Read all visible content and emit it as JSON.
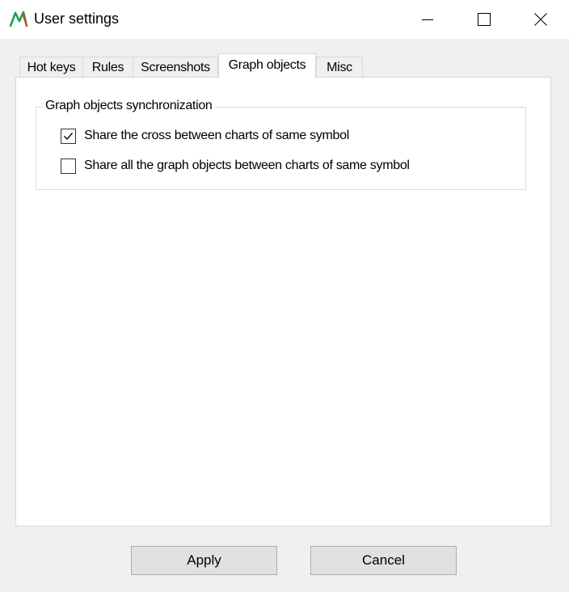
{
  "window": {
    "title": "User settings",
    "icon": "app-logo-icon",
    "controls": [
      "minimize-icon",
      "maximize-icon",
      "close-icon"
    ]
  },
  "tabs": [
    {
      "label": "Hot keys",
      "active": false
    },
    {
      "label": "Rules",
      "active": false
    },
    {
      "label": "Screenshots",
      "active": false
    },
    {
      "label": "Graph objects",
      "active": true
    },
    {
      "label": "Misc",
      "active": false
    }
  ],
  "group": {
    "legend": "Graph objects synchronization",
    "options": [
      {
        "label": "Share the cross between charts of same symbol",
        "checked": true
      },
      {
        "label": "Share all the graph objects between charts of same symbol",
        "checked": false
      }
    ]
  },
  "buttons": {
    "apply": "Apply",
    "cancel": "Cancel"
  },
  "colors": {
    "logo_green": "#1aa34a",
    "logo_red": "#e53935",
    "button_bg": "#e1e1e1",
    "panel_bg": "#ffffff",
    "window_bg": "#f0f0f0"
  }
}
